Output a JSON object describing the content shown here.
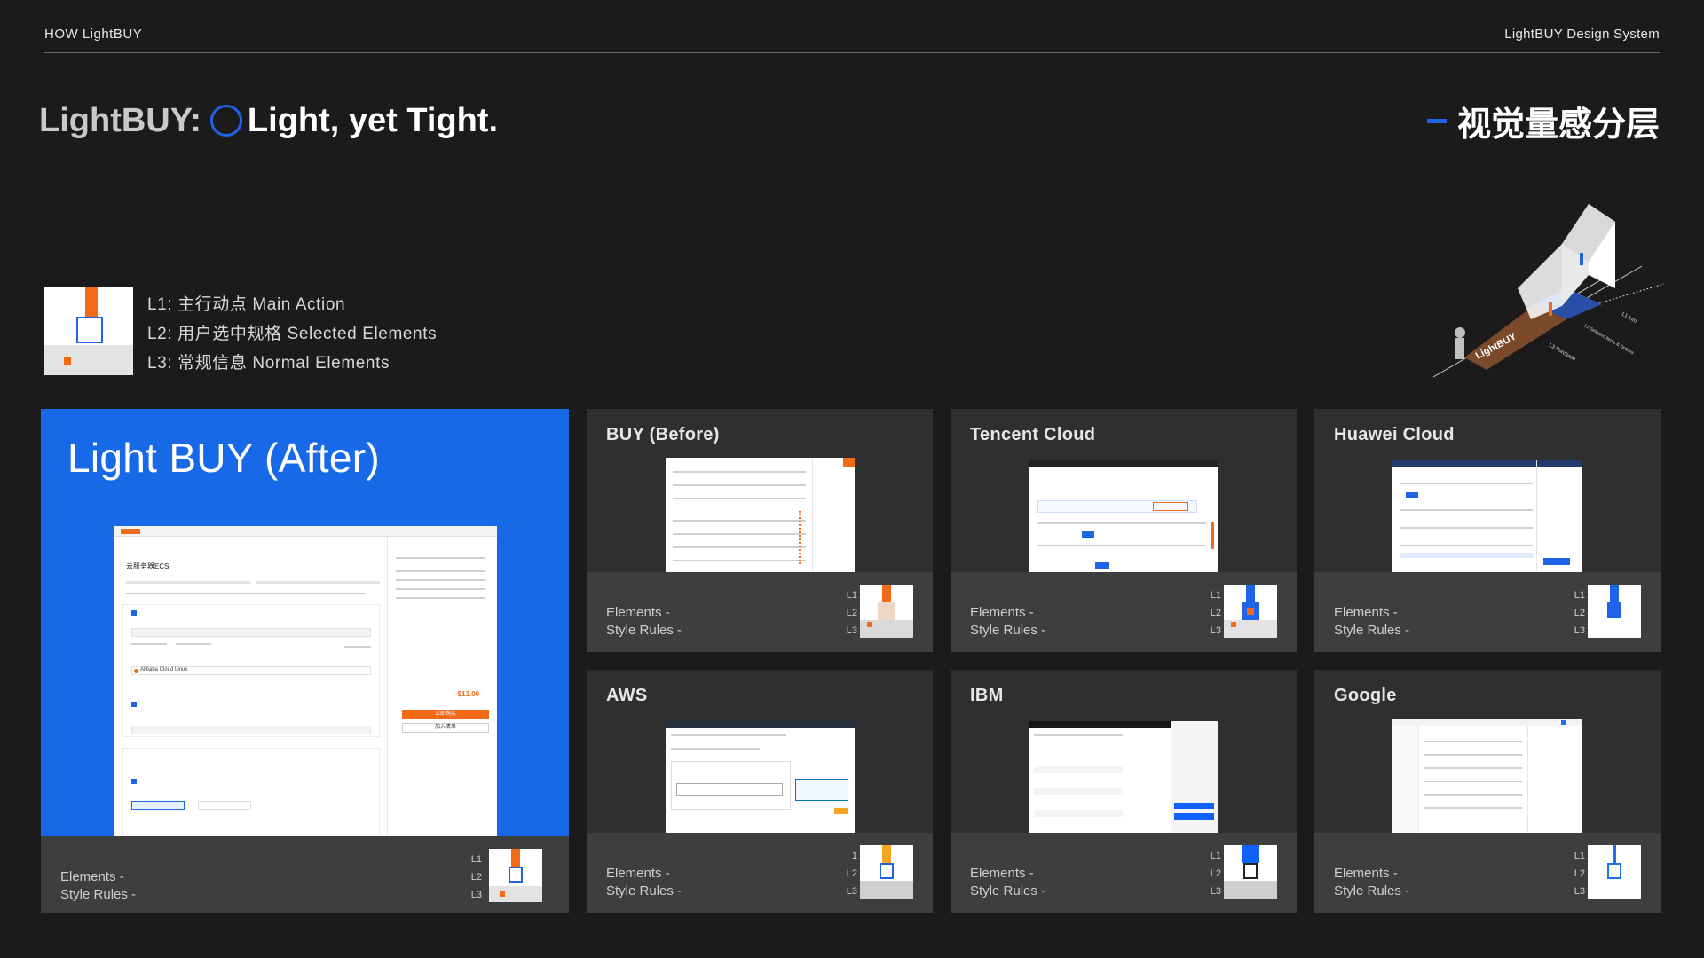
{
  "header": {
    "left": "HOW LightBUY",
    "right": "LightBUY Design System"
  },
  "hero": {
    "part1": "LightBUY:",
    "part2": "Light, yet Tight."
  },
  "section_title": "视觉量感分层",
  "legend": [
    {
      "text": "L1: 主行动点 Main Action"
    },
    {
      "text": "L2: 用户选中规格 Selected Elements"
    },
    {
      "text": "L3: 常规信息 Normal Elements"
    }
  ],
  "illustration": {
    "labels": [
      "LightBUY",
      "L1 Info",
      "L2 Selected Items & Options",
      "L3 Purchase"
    ]
  },
  "level_labels": [
    "L1",
    "L2",
    "L3"
  ],
  "level_labels_aws": [
    "1",
    "L2",
    "L3"
  ],
  "cards": [
    {
      "title": "Light BUY (After)",
      "elements": "Elements -",
      "style": "Style Rules -"
    },
    {
      "title": "BUY (Before)",
      "elements": "Elements -",
      "style": "Style Rules -"
    },
    {
      "title": "Tencent Cloud",
      "elements": "Elements -",
      "style": "Style Rules -"
    },
    {
      "title": "Huawei Cloud",
      "elements": "Elements -",
      "style": "Style Rules -"
    },
    {
      "title": "AWS",
      "elements": "Elements -",
      "style": "Style Rules -"
    },
    {
      "title": "IBM",
      "elements": "Elements -",
      "style": "Style Rules -"
    },
    {
      "title": "Google",
      "elements": "Elements -",
      "style": "Style Rules -"
    }
  ],
  "after_shot": {
    "product": "云服务器ECS",
    "price": "-$13.00",
    "buy_btn": "立即购买",
    "cart_btn": "加入清单",
    "os": "Alibaba Cloud Linux"
  },
  "colors": {
    "accent_blue": "#1769e8",
    "accent_orange": "#f06a17",
    "background": "#1b1b1b",
    "card": "#2f2f2f",
    "card_footer": "#3e3e3e"
  }
}
